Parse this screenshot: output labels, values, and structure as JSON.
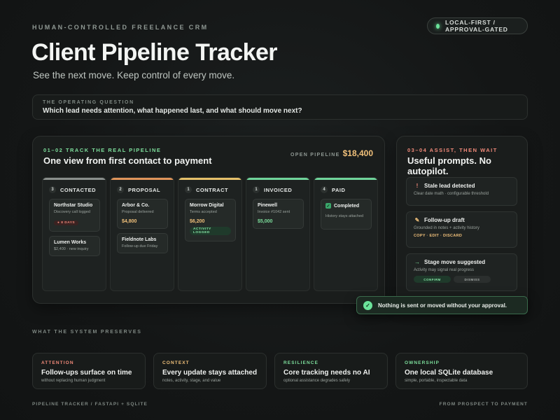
{
  "header": {
    "eyebrow": "HUMAN-CONTROLLED FREELANCE CRM",
    "badge": "LOCAL-FIRST / APPROVAL-GATED",
    "title": "Client Pipeline Tracker",
    "subtitle": "See the next move. Keep control of every move."
  },
  "question": {
    "label": "THE OPERATING QUESTION",
    "text": "Which lead needs attention, what happened last, and what should move next?"
  },
  "pipeline": {
    "label": "01–02 TRACK THE REAL PIPELINE",
    "title": "One view from first contact to payment",
    "open_label": "OPEN PIPELINE",
    "open_value": "$18,400",
    "columns": [
      {
        "count": "3",
        "name": "CONTACTED",
        "color": "#8a8f8c",
        "cards": [
          {
            "title": "Northstar Studio",
            "sub": "Discovery call logged",
            "pill": "● 8 DAYS"
          },
          {
            "title": "Lumen Works",
            "sub": "$2,400 · new inquiry"
          }
        ]
      },
      {
        "count": "2",
        "name": "PROPOSAL",
        "color": "#e0955a",
        "cards": [
          {
            "title": "Arbor & Co.",
            "sub": "Proposal delivered",
            "value": "$4,800"
          },
          {
            "title": "Fieldnote Labs",
            "sub": "Follow-up due Friday"
          }
        ]
      },
      {
        "count": "1",
        "name": "CONTRACT",
        "color": "#e6c06a",
        "cards": [
          {
            "title": "Morrow Digital",
            "sub": "Terms accepted",
            "value": "$6,200",
            "pill": "ACTIVITY LOGGED"
          }
        ]
      },
      {
        "count": "1",
        "name": "INVOICED",
        "color": "#6fd49a",
        "cards": [
          {
            "title": "Pinewell",
            "sub": "Invoice #1042 sent",
            "value": "$5,000"
          }
        ]
      },
      {
        "count": "4",
        "name": "PAID",
        "color": "#6fd49a",
        "cards": [
          {
            "title": "Completed",
            "sub": "History stays attached"
          }
        ]
      }
    ]
  },
  "assist": {
    "label": "03–04 ASSIST, THEN WAIT",
    "title": "Useful prompts. No autopilot.",
    "cards": [
      {
        "icon": "!",
        "title": "Stale lead detected",
        "sub": "Clear date math · configurable threshold"
      },
      {
        "icon": "✎",
        "title": "Follow-up draft",
        "sub": "Grounded in notes + activity history",
        "actions": "COPY · EDIT · DISCARD"
      },
      {
        "icon": "→",
        "title": "Stage move suggested",
        "sub": "Activity may signal real progress",
        "confirm": "CONFIRM",
        "dismiss": "DISMISS"
      }
    ]
  },
  "approval": {
    "text": "Nothing is sent or moved without your approval."
  },
  "preserves": {
    "label": "WHAT THE SYSTEM PRESERVES",
    "cards": [
      {
        "label": "ATTENTION",
        "color": "#f28a7a",
        "title": "Follow-ups surface on time",
        "sub": "without replacing human judgment"
      },
      {
        "label": "CONTEXT",
        "color": "#f0c07a",
        "title": "Every update stays attached",
        "sub": "notes, activity, stage, and value"
      },
      {
        "label": "RESILIENCE",
        "color": "#7ddf9c",
        "title": "Core tracking needs no AI",
        "sub": "optional assistance degrades safely"
      },
      {
        "label": "OWNERSHIP",
        "color": "#7ddf9c",
        "title": "One local SQLite database",
        "sub": "simple, portable, inspectable data"
      }
    ]
  },
  "footer": {
    "left": "PIPELINE TRACKER / FASTAPI + SQLITE",
    "right": "FROM PROSPECT TO PAYMENT"
  }
}
